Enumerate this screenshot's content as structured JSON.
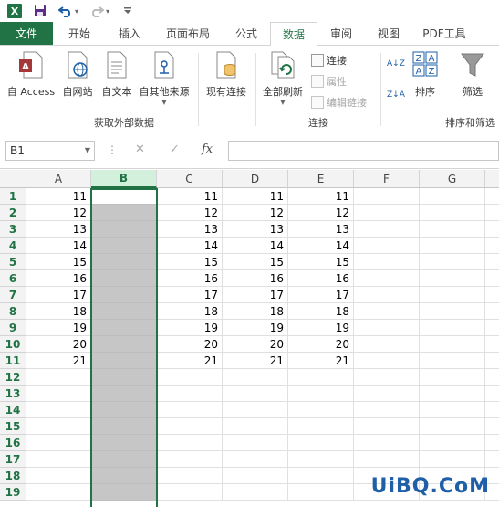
{
  "qat": {
    "app_icon": "X",
    "save_icon": "save-icon",
    "undo_icon": "undo-icon",
    "redo_icon": "redo-icon",
    "customize_icon": "customize-icon"
  },
  "tabs": [
    {
      "label": "文件"
    },
    {
      "label": "开始"
    },
    {
      "label": "插入"
    },
    {
      "label": "页面布局"
    },
    {
      "label": "公式"
    },
    {
      "label": "数据"
    },
    {
      "label": "审阅"
    },
    {
      "label": "视图"
    },
    {
      "label": "PDF工具"
    }
  ],
  "ribbon": {
    "get_external": {
      "label": "获取外部数据",
      "buttons": [
        "自 Access",
        "自网站",
        "自文本",
        "自其他来源"
      ]
    },
    "existing": "现有连接",
    "connections": {
      "label": "连接",
      "refresh_all": "全部刷新",
      "connect": "连接",
      "properties": "属性",
      "edit_links": "编辑链接"
    },
    "sort_filter": {
      "label": "排序和筛选",
      "sort": "排序",
      "filter": "筛选",
      "sort_az": "A↓Z",
      "sort_za": "Z↓A"
    }
  },
  "formula_bar": {
    "name_box": "B1",
    "cancel": "✕",
    "enter": "✓",
    "fx": "fx",
    "value": ""
  },
  "columns": [
    "A",
    "B",
    "C",
    "D",
    "E",
    "F",
    "G"
  ],
  "rows": [
    "1",
    "2",
    "3",
    "4",
    "5",
    "6",
    "7",
    "8",
    "9",
    "10",
    "11",
    "12",
    "13",
    "14",
    "15",
    "16",
    "17",
    "18",
    "19"
  ],
  "data": {
    "A": [
      "11",
      "12",
      "13",
      "14",
      "15",
      "16",
      "17",
      "18",
      "19",
      "20",
      "21"
    ],
    "C": [
      "11",
      "12",
      "13",
      "14",
      "15",
      "16",
      "17",
      "18",
      "19",
      "20",
      "21"
    ],
    "D": [
      "11",
      "12",
      "13",
      "14",
      "15",
      "16",
      "17",
      "18",
      "19",
      "20",
      "21"
    ],
    "E": [
      "11",
      "12",
      "13",
      "14",
      "15",
      "16",
      "17",
      "18",
      "19",
      "20",
      "21"
    ]
  },
  "selected_column": "B",
  "watermark": "UiBQ.CoM",
  "colors": {
    "accent": "#217346",
    "selection_fill": "#c6c6c6"
  }
}
